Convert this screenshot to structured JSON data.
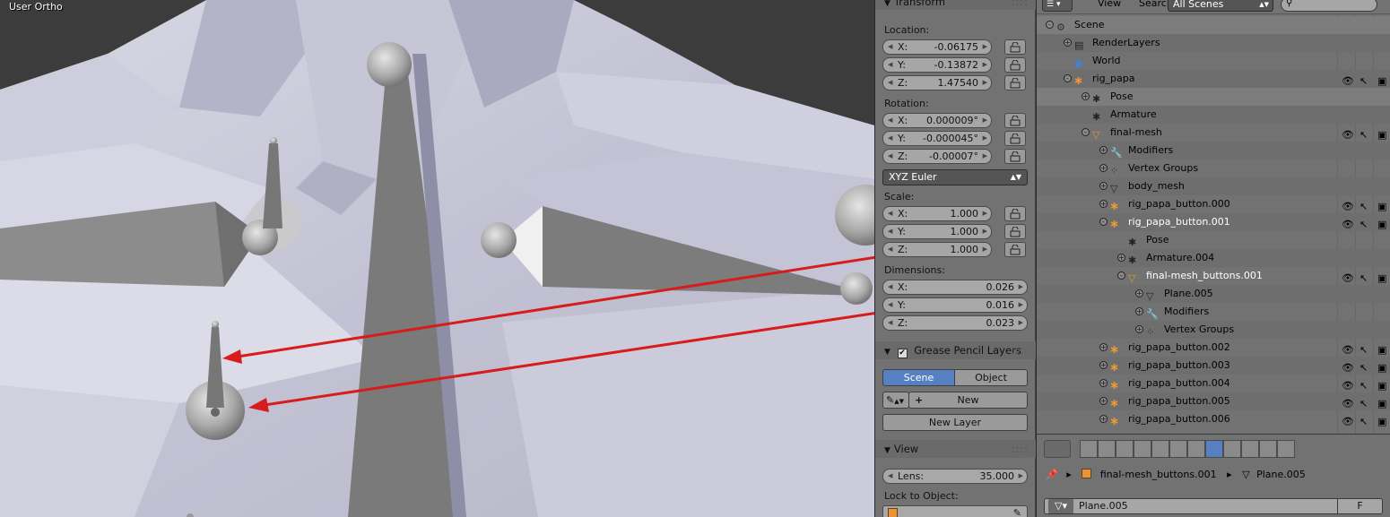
{
  "viewport": {
    "mode_label": "User Ortho"
  },
  "npanel": {
    "transform_title": "Transform",
    "location_label": "Location:",
    "location": [
      {
        "axis": "X:",
        "value": "-0.06175"
      },
      {
        "axis": "Y:",
        "value": "-0.13872"
      },
      {
        "axis": "Z:",
        "value": "1.47540"
      }
    ],
    "rotation_label": "Rotation:",
    "rotation": [
      {
        "axis": "X:",
        "value": "0.000009°"
      },
      {
        "axis": "Y:",
        "value": "-0.000045°"
      },
      {
        "axis": "Z:",
        "value": "-0.00007°"
      }
    ],
    "rotation_mode": "XYZ Euler",
    "scale_label": "Scale:",
    "scale": [
      {
        "axis": "X:",
        "value": "1.000"
      },
      {
        "axis": "Y:",
        "value": "1.000"
      },
      {
        "axis": "Z:",
        "value": "1.000"
      }
    ],
    "dimensions_label": "Dimensions:",
    "dimensions": [
      {
        "axis": "X:",
        "value": "0.026"
      },
      {
        "axis": "Y:",
        "value": "0.016"
      },
      {
        "axis": "Z:",
        "value": "0.023"
      }
    ],
    "grease_title": "Grease Pencil Layers",
    "grease_tabs": [
      "Scene",
      "Object"
    ],
    "grease_new": "New",
    "grease_new_layer": "New Layer",
    "view_title": "View",
    "lens_label": "Lens:",
    "lens_value": "35.000",
    "lock_label": "Lock to Object:"
  },
  "outliner": {
    "header": {
      "view": "View",
      "search": "Search",
      "scenes": "All Scenes"
    },
    "rows": [
      {
        "name": "Scene",
        "indent": 0,
        "expand": "-",
        "icon": "scene-icon"
      },
      {
        "name": "RenderLayers",
        "indent": 1,
        "expand": "+",
        "icon": "renderlayers-icon"
      },
      {
        "name": "World",
        "indent": 1,
        "expand": "",
        "icon": "world-icon"
      },
      {
        "name": "rig_papa",
        "indent": 1,
        "expand": "-",
        "icon": "armature-icon"
      },
      {
        "name": "Pose",
        "indent": 2,
        "expand": "+",
        "icon": "pose-icon"
      },
      {
        "name": "Armature",
        "indent": 2,
        "expand": "",
        "icon": "armature-data-icon"
      },
      {
        "name": "final-mesh",
        "indent": 2,
        "expand": "-",
        "icon": "mesh-icon"
      },
      {
        "name": "Modifiers",
        "indent": 3,
        "expand": "+",
        "icon": "wrench-icon"
      },
      {
        "name": "Vertex Groups",
        "indent": 3,
        "expand": "+",
        "icon": "vertex-groups-icon"
      },
      {
        "name": "body_mesh",
        "indent": 3,
        "expand": "+",
        "icon": "mesh-data-icon"
      },
      {
        "name": "rig_papa_button.000",
        "indent": 3,
        "expand": "+",
        "icon": "armature-icon"
      },
      {
        "name": "rig_papa_button.001",
        "indent": 3,
        "expand": "-",
        "icon": "armature-icon"
      },
      {
        "name": "Pose",
        "indent": 4,
        "expand": "",
        "icon": "pose-icon"
      },
      {
        "name": "Armature.004",
        "indent": 4,
        "expand": "+",
        "icon": "armature-data-icon"
      },
      {
        "name": "final-mesh_buttons.001",
        "indent": 4,
        "expand": "-",
        "icon": "mesh-icon"
      },
      {
        "name": "Plane.005",
        "indent": 5,
        "expand": "+",
        "icon": "mesh-data-icon"
      },
      {
        "name": "Modifiers",
        "indent": 5,
        "expand": "+",
        "icon": "wrench-icon"
      },
      {
        "name": "Vertex Groups",
        "indent": 5,
        "expand": "+",
        "icon": "vertex-groups-icon"
      },
      {
        "name": "rig_papa_button.002",
        "indent": 3,
        "expand": "+",
        "icon": "armature-icon"
      },
      {
        "name": "rig_papa_button.003",
        "indent": 3,
        "expand": "+",
        "icon": "armature-icon"
      },
      {
        "name": "rig_papa_button.004",
        "indent": 3,
        "expand": "+",
        "icon": "armature-icon"
      },
      {
        "name": "rig_papa_button.005",
        "indent": 3,
        "expand": "+",
        "icon": "armature-icon"
      },
      {
        "name": "rig_papa_button.006",
        "indent": 3,
        "expand": "+",
        "icon": "armature-icon"
      }
    ]
  },
  "properties": {
    "breadcrumb_object": "final-mesh_buttons.001",
    "breadcrumb_data": "Plane.005",
    "data_name": "Plane.005",
    "fake_user": "F"
  },
  "colors": {
    "accent": "#5680c2",
    "arrow": "#d81c1c",
    "orange": "#e8953a"
  }
}
